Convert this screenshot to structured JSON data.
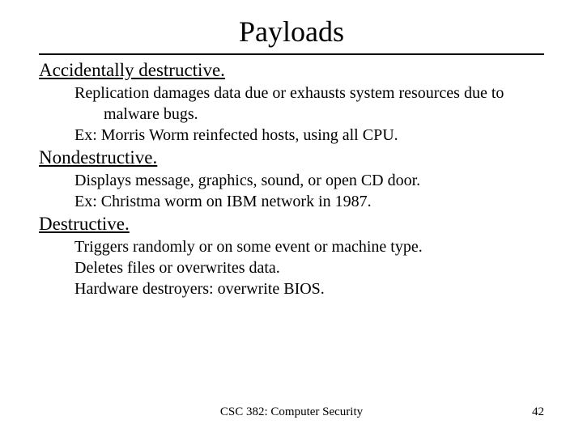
{
  "title": "Payloads",
  "sections": [
    {
      "heading": "Accidentally destructive.",
      "lines": [
        "Replication damages data due or exhausts system resources due to malware bugs.",
        "Ex: Morris Worm reinfected hosts, using all CPU."
      ]
    },
    {
      "heading": "Nondestructive.",
      "lines": [
        "Displays message, graphics, sound, or open CD door.",
        "Ex: Christma worm on IBM network in 1987."
      ]
    },
    {
      "heading": "Destructive.",
      "lines": [
        "Triggers randomly or on some event or machine type.",
        "Deletes files or overwrites data.",
        "Hardware destroyers: overwrite BIOS."
      ]
    }
  ],
  "footer": {
    "center": "CSC 382: Computer Security",
    "page": "42"
  }
}
